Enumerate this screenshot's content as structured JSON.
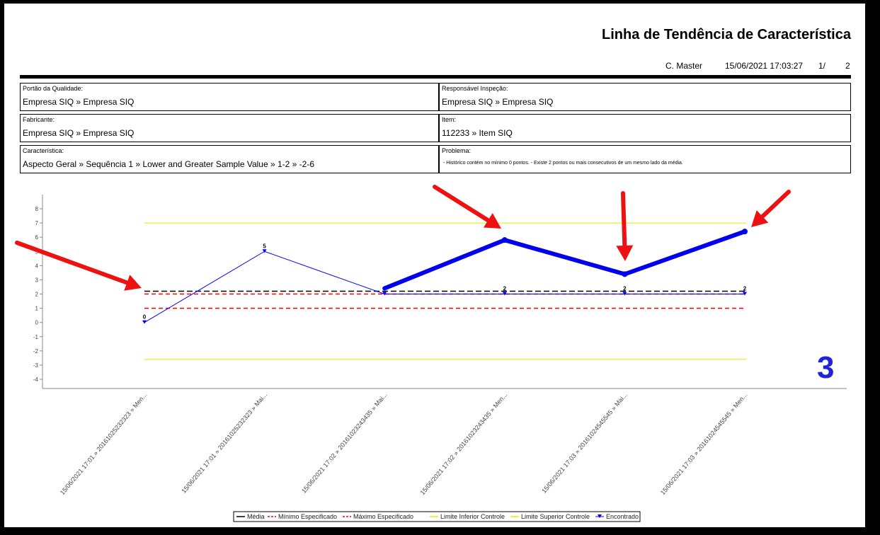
{
  "report": {
    "title": "Linha de Tendência de Característica",
    "user": "C. Master",
    "datetime": "15/06/2021 17:03:27",
    "page_current": "1/",
    "page_total": "2"
  },
  "fields": {
    "portao": {
      "label": "Portão da Qualidade:",
      "value": "Empresa SIQ » Empresa SIQ"
    },
    "responsavel": {
      "label": "Responsável Inspeção:",
      "value": "Empresa SIQ » Empresa SIQ"
    },
    "fabricante": {
      "label": "Fabricante:",
      "value": "Empresa SIQ » Empresa SIQ"
    },
    "item": {
      "label": "Item:",
      "value": "112233 » Item SIQ"
    },
    "caracteristica": {
      "label": "Característica:",
      "value": "Aspecto Geral » Sequência 1 » Lower and Greater Sample Value » 1-2 » -2-6"
    },
    "problema": {
      "label": "Problema:",
      "value": " - Histórico contém no mínimo 0 pontos. - Existe 2 pontos ou mais consecutivos de um mesmo lado da média."
    }
  },
  "annotation_number": "3",
  "chart_data": {
    "type": "line",
    "categories": [
      "15/06/2021 17:01 » 20161025232323 » Men...",
      "15/06/2021 17:01 » 20161025232323 » Mai...",
      "15/06/2021 17:02 » 20161023243435 » Mai...",
      "15/06/2021 17:02 » 20161023243435 » Men...",
      "15/06/2021 17:03 » 20161024545545 » Mai...",
      "15/06/2021 17:03 » 20161024545545 » Men..."
    ],
    "ylim": [
      -4,
      8
    ],
    "yticks": [
      "8",
      "7",
      "6",
      "5",
      "4",
      "3",
      "2",
      "1",
      "0",
      "-1",
      "-2",
      "-3",
      "-4"
    ],
    "media": 2.2,
    "minimo_especificado": 1,
    "maximo_especificado": 2,
    "limite_inferior_controle": -2.6,
    "limite_superior_controle": 7,
    "series": [
      {
        "name": "Encontrado",
        "values": [
          0,
          5,
          2,
          2,
          2,
          2
        ],
        "labels": [
          "0",
          "5",
          "",
          "2",
          "2",
          "2"
        ]
      }
    ],
    "highlight": {
      "values": [
        2.4,
        5.8,
        3.4,
        6.4
      ],
      "start_index": 2
    },
    "legend": {
      "placement": "bottom",
      "items": [
        {
          "label": "Média",
          "color": "#000000",
          "style": "solid"
        },
        {
          "label": "Mínimo Especificado",
          "color": "#ff0000",
          "style": "dashed"
        },
        {
          "label": "Máximo Especificado",
          "color": "#ff0000",
          "style": "dashed"
        },
        {
          "label": "Limite Inferior Controle",
          "color": "#e8e800",
          "style": "solid"
        },
        {
          "label": "Limite Superior Controle",
          "color": "#e8e800",
          "style": "solid"
        },
        {
          "label": "Encontrado",
          "color": "#0000ff",
          "style": "marker"
        }
      ]
    }
  },
  "colors": {
    "series": "#0000ff",
    "highlight": "#0000ee",
    "arrow": "#ee1111",
    "media": "#000000",
    "spec": "#ff0000",
    "control": "#e8e800"
  }
}
